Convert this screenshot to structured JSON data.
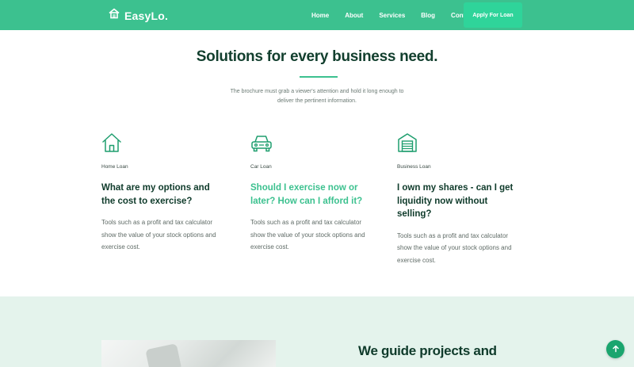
{
  "nav": {
    "brand": "EasyLo.",
    "links": [
      "Home",
      "About",
      "Services",
      "Blog",
      "Contact"
    ],
    "cta": "Apply For Loan"
  },
  "solutions": {
    "title": "Solutions for every business need.",
    "subtitle": "The brochure must grab a viewer's attention and hold it long enough to deliver the pertinent information.",
    "cards": [
      {
        "icon": "house-icon",
        "tag": "Home Loan",
        "heading": "What are my options and the cost to exercise?",
        "text": "Tools such as a profit and tax calculator show the value of your stock options and exercise cost."
      },
      {
        "icon": "car-icon",
        "tag": "Car Loan",
        "heading": "Should I exercise now or later? How can I afford it?",
        "text": "Tools such as a profit and tax calculator show the value of your stock options and exercise cost."
      },
      {
        "icon": "warehouse-icon",
        "tag": "Business Loan",
        "heading": "I own my shares - can I get liquidity now without selling?",
        "text": "Tools such as a profit and tax calculator show the value of your stock options and exercise cost."
      }
    ]
  },
  "about": {
    "title": "We guide projects and"
  },
  "colors": {
    "primary": "#3cc18f",
    "accent_button": "#2fd49a",
    "dark_text": "#0f3b2b",
    "section_bg": "#e4f3ec",
    "back_to_top": "#1aa56e"
  }
}
